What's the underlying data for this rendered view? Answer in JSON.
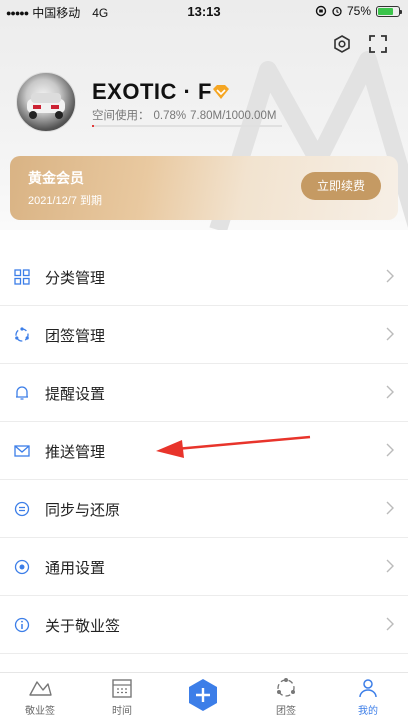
{
  "status_bar": {
    "carrier": "中国移动",
    "network": "4G",
    "time": "13:13",
    "battery": "75%",
    "battery_level": 0.75
  },
  "profile": {
    "username": "EXOTIC · F",
    "usage_label": "空间使用：",
    "usage_percent": "0.78%",
    "usage_amount": "7.80M/1000.00M",
    "usage_fraction": 0.0078
  },
  "vip": {
    "title": "黄金会员",
    "expiry": "2021/12/7 到期",
    "renew_label": "立即续费"
  },
  "menu": [
    {
      "label": "分类管理",
      "icon": "grid-icon"
    },
    {
      "label": "团签管理",
      "icon": "team-icon"
    },
    {
      "label": "提醒设置",
      "icon": "bell-icon"
    },
    {
      "label": "推送管理",
      "icon": "mail-icon"
    },
    {
      "label": "同步与还原",
      "icon": "sync-icon"
    },
    {
      "label": "通用设置",
      "icon": "settings-dot-icon"
    },
    {
      "label": "关于敬业签",
      "icon": "info-icon"
    }
  ],
  "tabs": [
    {
      "label": "敬业签",
      "icon": "note-icon",
      "active": false
    },
    {
      "label": "时间",
      "icon": "calendar-icon",
      "active": false
    },
    {
      "label": "",
      "icon": "plus-icon",
      "active": false
    },
    {
      "label": "团签",
      "icon": "team-tab-icon",
      "active": false
    },
    {
      "label": "我的",
      "icon": "person-icon",
      "active": true
    }
  ],
  "colors": {
    "accent_blue": "#3c7ee8",
    "vip_gold": "#c59a63",
    "annotation_red": "#e8342b",
    "battery_green": "#3bc44b"
  }
}
